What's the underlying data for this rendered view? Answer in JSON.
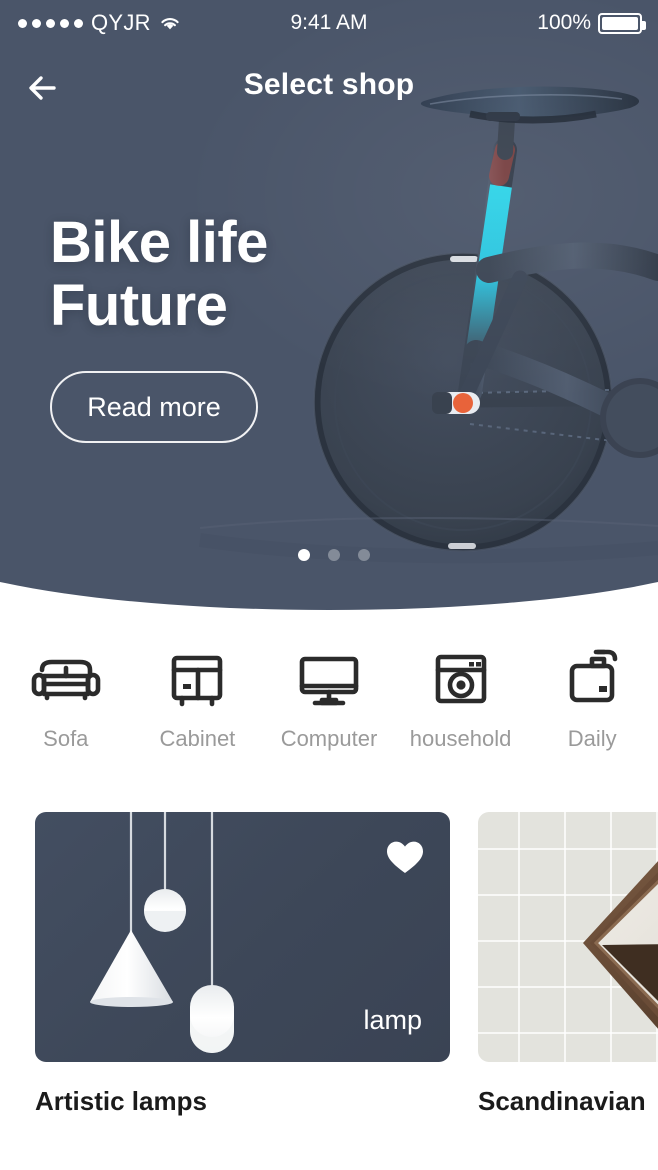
{
  "status_bar": {
    "signal_dots": 5,
    "carrier": "QYJR",
    "wifi_icon": "wifi-icon",
    "time": "9:41 AM",
    "battery_percent": "100%",
    "battery_icon": "battery-full-icon"
  },
  "nav": {
    "back_icon": "arrow-left-icon",
    "title": "Select shop"
  },
  "hero": {
    "title_line1": "Bike life",
    "title_line2": "Future",
    "cta_label": "Read more",
    "illustration": "bicycle-illustration",
    "carousel": {
      "count": 3,
      "active_index": 0
    },
    "colors": {
      "background": "#4a5569",
      "accent_cyan": "#2dd4e8",
      "hub_orange": "#e8633a"
    }
  },
  "categories": [
    {
      "label": "Sofa",
      "icon": "sofa-icon"
    },
    {
      "label": "Cabinet",
      "icon": "cabinet-icon"
    },
    {
      "label": "Computer",
      "icon": "monitor-icon"
    },
    {
      "label": "household",
      "icon": "washing-machine-icon"
    },
    {
      "label": "Daily",
      "icon": "soap-dispenser-icon"
    }
  ],
  "products": [
    {
      "title": "Artistic lamps",
      "image_tag": "lamp",
      "favorite_icon": "heart-filled-icon",
      "favorited": true,
      "image_background": "#3d4758",
      "image_subject": "hanging-pendant-lamps"
    },
    {
      "title": "Scandinavian",
      "image_tag": "",
      "favorite_icon": "",
      "favorited": false,
      "image_background": "#e3e3dd",
      "image_subject": "hexagonal-wood-shelf-mirror"
    }
  ]
}
